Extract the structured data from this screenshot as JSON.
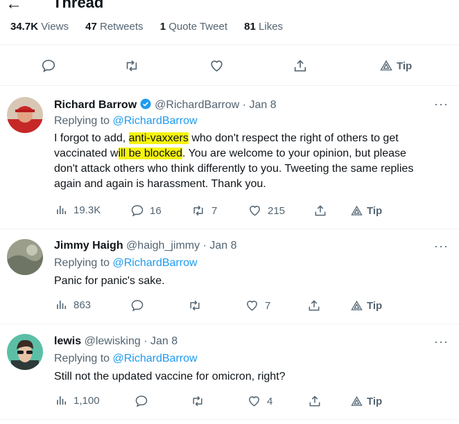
{
  "header": {
    "back_icon": "arrow-left-icon",
    "title": "Thread"
  },
  "stats": {
    "views_count": "34.7K",
    "views_label": "Views",
    "retweets_count": "47",
    "retweets_label": "Retweets",
    "quotes_count": "1",
    "quotes_label": "Quote Tweet",
    "likes_count": "81",
    "likes_label": "Likes"
  },
  "main_actions": {
    "tip_label": "Tip"
  },
  "tweets": [
    {
      "name": "Richard Barrow",
      "verified": true,
      "handle": "@RichardBarrow",
      "sep": "·",
      "date": "Jan 8",
      "replying_prefix": "Replying to",
      "replying_to": "@RichardBarrow",
      "text_parts": [
        "I forgot to add, ",
        "anti-vaxxers",
        " who don't respect the right of others to get",
        "vaccinated w",
        "ill be blocked",
        ". You are welcome to your opinion, but please",
        "don't attack others who think differently to you. Tweeting the same replies",
        "again and again is harassment. Thank you."
      ],
      "views": "19.3K",
      "replies": "16",
      "retweets": "7",
      "likes": "215",
      "tip": "Tip"
    },
    {
      "name": "Jimmy Haigh",
      "handle": "@haigh_jimmy",
      "sep": "·",
      "date": "Jan 8",
      "replying_prefix": "Replying to",
      "replying_to": "@RichardBarrow",
      "text": "Panic for panic's sake.",
      "views": "863",
      "replies": "",
      "retweets": "",
      "likes": "7",
      "tip": "Tip"
    },
    {
      "name": "lewis",
      "handle": "@lewisking",
      "sep": "·",
      "date": "Jan 8",
      "replying_prefix": "Replying to",
      "replying_to": "@RichardBarrow",
      "text": "Still not the updated vaccine for omicron, right?",
      "views": "1,100",
      "replies": "",
      "retweets": "",
      "likes": "4",
      "tip": "Tip"
    }
  ],
  "colors": {
    "accent": "#1d9bf0",
    "muted": "#536471",
    "highlight": "#f6f30e",
    "divider": "#eff3f4"
  }
}
